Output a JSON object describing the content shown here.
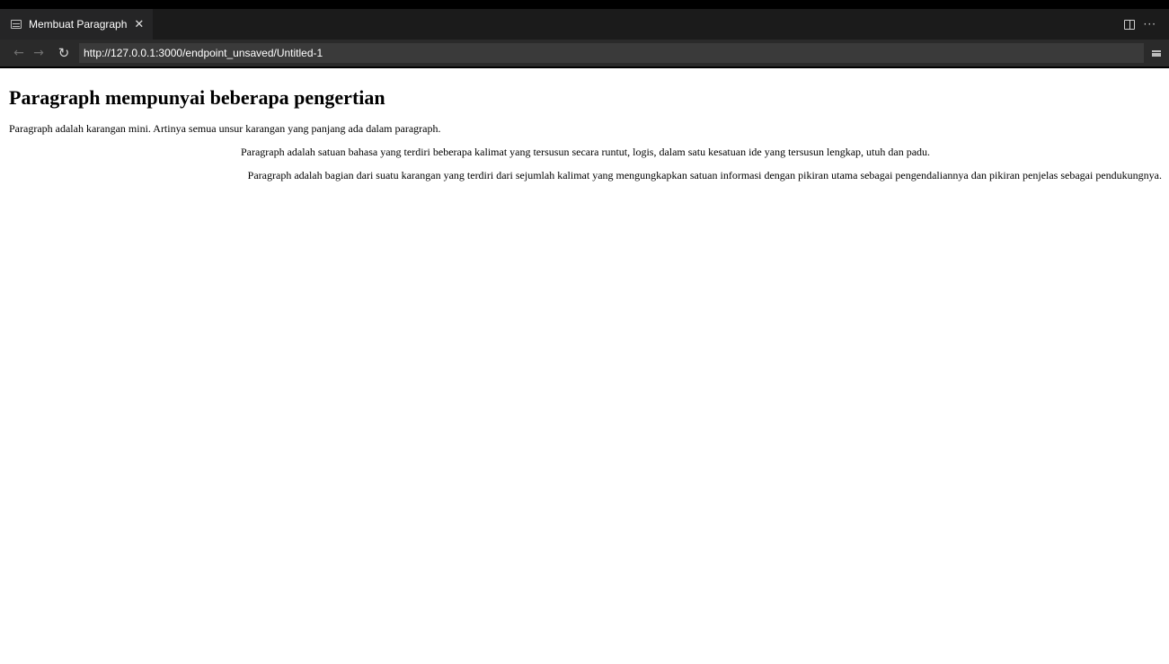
{
  "browser": {
    "tab": {
      "title": "Membuat Paragraph",
      "close_glyph": "✕",
      "icon": "preview-icon"
    },
    "toolbar_right": {
      "split_icon": "split-editor-icon",
      "more_glyph": "···"
    },
    "nav": {
      "back_glyph": "←",
      "forward_glyph": "→",
      "reload_glyph": "↻",
      "url": "http://127.0.0.1:3000/endpoint_unsaved/Untitled-1",
      "menu_icon": "hamburger-menu-icon"
    }
  },
  "page": {
    "heading": "Paragraph mempunyai beberapa pengertian",
    "paragraphs": [
      "Paragraph adalah karangan mini. Artinya semua unsur karangan yang panjang ada dalam paragraph.",
      "Paragraph adalah satuan bahasa yang terdiri beberapa kalimat yang tersusun secara runtut, logis, dalam satu kesatuan ide yang tersusun lengkap, utuh dan padu.",
      "Paragraph adalah bagian dari suatu karangan yang terdiri dari sejumlah kalimat yang mengungkapkan satuan informasi dengan pikiran utama sebagai pengendaliannya dan pikiran penjelas sebagai pendukungnya."
    ]
  },
  "colors": {
    "chrome_dark": "#1b1b1b",
    "tab_bg": "#252526",
    "address_bar": "#2a2a2a",
    "url_field": "#3a3a3a",
    "page_bg": "#ffffff"
  }
}
